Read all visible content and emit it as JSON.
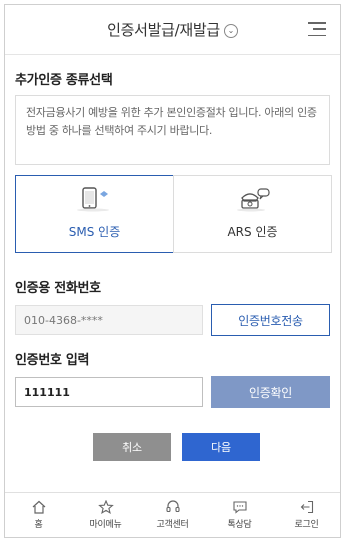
{
  "header": {
    "title": "인증서발급/재발급",
    "title_icon": "chevron-down-circle-icon",
    "menu_icon": "hamburger-menu-icon"
  },
  "auth_type": {
    "section_title": "추가인증 종류선택",
    "notice": "전자금융사기 예방을 위한 추가 본인인증절차 입니다. 아래의 인증방법 중 하나를 선택하여 주시기 바랍니다.",
    "methods": [
      {
        "label": "SMS 인증",
        "icon": "smartphone-icon",
        "selected": true
      },
      {
        "label": "ARS 인증",
        "icon": "telephone-icon",
        "selected": false
      }
    ]
  },
  "phone": {
    "section_title": "인증용 전화번호",
    "value": "010-4368-****",
    "send_button": "인증번호전송"
  },
  "code": {
    "section_title": "인증번호 입력",
    "value": "111111",
    "confirm_button": "인증확인"
  },
  "actions": {
    "cancel": "취소",
    "next": "다음"
  },
  "tabbar": [
    {
      "label": "홈",
      "icon": "home-icon"
    },
    {
      "label": "마이메뉴",
      "icon": "star-icon"
    },
    {
      "label": "고객센터",
      "icon": "headset-icon"
    },
    {
      "label": "톡상담",
      "icon": "chat-icon"
    },
    {
      "label": "로그인",
      "icon": "login-icon"
    }
  ],
  "colors": {
    "accent": "#2a5db0",
    "confirm_disabled": "#7f98c6",
    "next": "#2f66d0",
    "cancel": "#8f8f8f"
  }
}
